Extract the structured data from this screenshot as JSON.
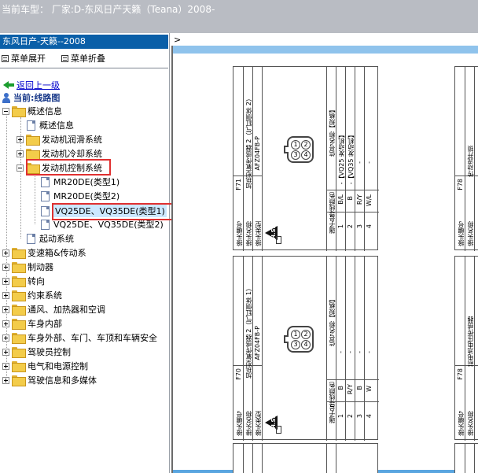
{
  "header": {
    "title": "当前车型： 厂家:D-东风日产天籁（Teana）2008-"
  },
  "left_pane": {
    "title": "东风日产-天籁--2008",
    "expand_all": "菜单展开",
    "collapse_all": "菜单折叠",
    "back_link": "返回上一级",
    "current": "当前:线路图",
    "tree": [
      {
        "label": "概述信息",
        "type": "folder",
        "state": "open",
        "level": 0
      },
      {
        "label": "概述信息",
        "type": "doc",
        "level": 1
      },
      {
        "label": "发动机润滑系统",
        "type": "folder",
        "state": "closed",
        "level": 1
      },
      {
        "label": "发动机冷却系统",
        "type": "folder",
        "state": "closed",
        "level": 1
      },
      {
        "label": "发动机控制系统",
        "type": "folder",
        "state": "open",
        "level": 1
      },
      {
        "label": "MR20DE(类型1)",
        "type": "doc",
        "level": 2
      },
      {
        "label": "MR20DE(类型2)",
        "type": "doc",
        "level": 2
      },
      {
        "label": "VQ25DE、VQ35DE(类型1)",
        "type": "doc",
        "level": 2,
        "selected": true
      },
      {
        "label": "VQ25DE、VQ35DE(类型2)",
        "type": "doc",
        "level": 2
      },
      {
        "label": "起动系统",
        "type": "doc",
        "level": 1
      },
      {
        "label": "变速箱&传动系",
        "type": "folder",
        "state": "closed",
        "level": 0
      },
      {
        "label": "制动器",
        "type": "folder",
        "state": "closed",
        "level": 0
      },
      {
        "label": "转向",
        "type": "folder",
        "state": "closed",
        "level": 0
      },
      {
        "label": "约束系统",
        "type": "folder",
        "state": "closed",
        "level": 0
      },
      {
        "label": "通风、加热器和空调",
        "type": "folder",
        "state": "closed",
        "level": 0
      },
      {
        "label": "车身内部",
        "type": "folder",
        "state": "closed",
        "level": 0
      },
      {
        "label": "车身外部、车门、车顶和车辆安全",
        "type": "folder",
        "state": "closed",
        "level": 0
      },
      {
        "label": "驾驶员控制",
        "type": "folder",
        "state": "closed",
        "level": 0
      },
      {
        "label": "电气和电源控制",
        "type": "folder",
        "state": "closed",
        "level": 0
      },
      {
        "label": "驾驶信息和多媒体",
        "type": "folder",
        "state": "closed",
        "level": 0
      }
    ]
  },
  "right_pane": {
    "prompt": ">",
    "cards": [
      {
        "connector_no": "F71",
        "connector_name": "加热型氧传感器 2（气缸侧体 2）",
        "connector_type": "AFZ04FB-P",
        "hdr_connector_no": "接头编号",
        "hdr_connector_name": "接头名称",
        "hdr_connector_type": "接头类型",
        "hdr_terminal": "端子号",
        "hdr_wire_color": "导线颜色",
        "hdr_signal": "信号名称【规格】",
        "terminals": [
          "1",
          "2",
          "3",
          "4"
        ],
        "wire_colors": [
          "B/L",
          "B",
          "R/Y",
          "W/L"
        ],
        "signals": [
          "-【VQ25 发动机】",
          "-【VQ35 发动机】",
          "-",
          "-"
        ],
        "hs_label": "H.S."
      },
      {
        "connector_no": "F70",
        "connector_name": "加热型氧传感器 2（气缸侧体 1）",
        "connector_type": "AFZ04FB-P",
        "hdr_connector_no": "接头编号",
        "hdr_connector_name": "接头名称",
        "hdr_connector_type": "接头类型",
        "hdr_terminal": "端子号",
        "hdr_wire_color": "导线颜色",
        "hdr_signal": "信号名称【规格】",
        "terminals": [
          "1",
          "2",
          "3",
          "4"
        ],
        "wire_colors": [
          "B",
          "R/Y",
          "B",
          "W"
        ],
        "signals": [
          "-",
          "-",
          "-",
          "-"
        ],
        "hs_label": "H.S."
      }
    ],
    "side_cards": [
      {
        "connector_no": "F78",
        "connector_name": "传动流开锁"
      },
      {
        "connector_no": "F78",
        "connector_name": "前电池电压传感器"
      }
    ],
    "side_hdr_no": "接头编号",
    "side_hdr_name": "接头名称"
  },
  "colors": {
    "header_bg": "#b9bcc3",
    "pane_title_bg": "#0a5fa8",
    "highlight_box": "#e03030",
    "link": "#0000cc"
  }
}
